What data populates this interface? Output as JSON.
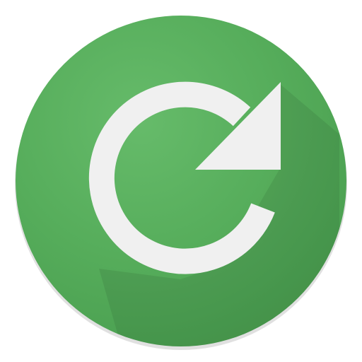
{
  "icon": {
    "name": "refresh-icon",
    "colors": {
      "background": "#ffffff",
      "circle": "#4caf50",
      "circle_highlight": "#66bb6a",
      "circle_edge": "#43a047",
      "long_shadow": "#3b8f40",
      "glyph": "#f1f1f1",
      "glyph_shade": "#e6e6e6"
    }
  }
}
